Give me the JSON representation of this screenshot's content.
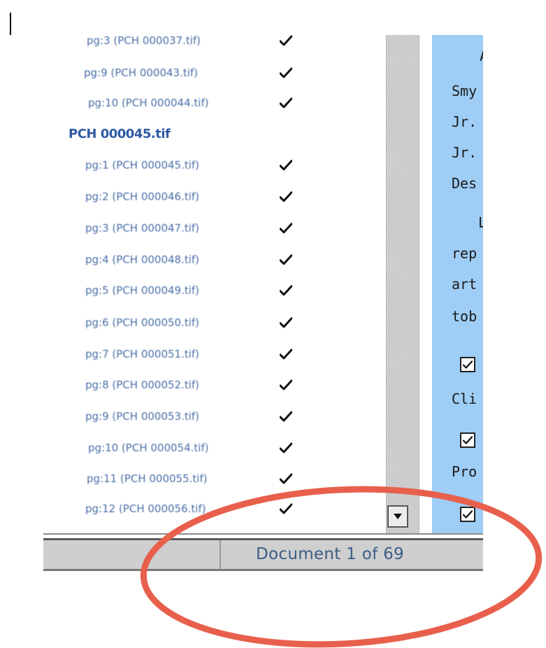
{
  "page_list": {
    "rows": [
      {
        "type": "page",
        "label": "pg:3 (PCH 000037.tif)",
        "checked": true
      },
      {
        "type": "page",
        "label": "pg:9 (PCH 000043.tif)",
        "checked": true
      },
      {
        "type": "page",
        "label": "pg:10 (PCH 000044.tif)",
        "checked": true
      },
      {
        "type": "doc",
        "label": "PCH 000045.tif",
        "checked": false
      },
      {
        "type": "page",
        "label": "pg:1 (PCH 000045.tif)",
        "checked": true
      },
      {
        "type": "page",
        "label": "pg:2 (PCH 000046.tif)",
        "checked": true
      },
      {
        "type": "page",
        "label": "pg:3 (PCH 000047.tif)",
        "checked": true
      },
      {
        "type": "page",
        "label": "pg:4 (PCH 000048.tif)",
        "checked": true
      },
      {
        "type": "page",
        "label": "pg:5 (PCH 000049.tif)",
        "checked": true
      },
      {
        "type": "page",
        "label": "pg:6 (PCH 000050.tif)",
        "checked": true
      },
      {
        "type": "page",
        "label": "pg:7 (PCH 000051.tif)",
        "checked": true
      },
      {
        "type": "page",
        "label": "pg:8 (PCH 000052.tif)",
        "checked": true
      },
      {
        "type": "page",
        "label": "pg:9 (PCH 000053.tif)",
        "checked": true
      },
      {
        "type": "page",
        "label": "pg:10 (PCH 000054.tif)",
        "checked": true
      },
      {
        "type": "page",
        "label": "pg:11 (PCH 000055.tif)",
        "checked": true
      },
      {
        "type": "page",
        "label": "pg:12 (PCH 000056.tif)",
        "checked": true
      }
    ]
  },
  "content_pane": {
    "lines": [
      {
        "text": "A",
        "kind": "text"
      },
      {
        "text": "Smy",
        "kind": "text"
      },
      {
        "text": "Jr.",
        "kind": "text"
      },
      {
        "text": "Jr.",
        "kind": "text"
      },
      {
        "text": "Des",
        "kind": "text"
      },
      {
        "text": "L",
        "kind": "text"
      },
      {
        "text": "rep",
        "kind": "text"
      },
      {
        "text": "art",
        "kind": "text"
      },
      {
        "text": "tob",
        "kind": "text"
      },
      {
        "text": "",
        "kind": "checkbox",
        "checked": true
      },
      {
        "text": "Cli",
        "kind": "text"
      },
      {
        "text": "",
        "kind": "checkbox",
        "checked": true
      },
      {
        "text": "Pro",
        "kind": "text"
      },
      {
        "text": "",
        "kind": "checkbox",
        "checked": true
      }
    ]
  },
  "status_bar": {
    "left_text": "",
    "document_position": "Document 1 of 69"
  },
  "annotation": {
    "shape": "ellipse",
    "color": "#e8604c"
  },
  "icons": {
    "check": "checkmark-icon",
    "scroll_down": "arrow-down-icon"
  }
}
